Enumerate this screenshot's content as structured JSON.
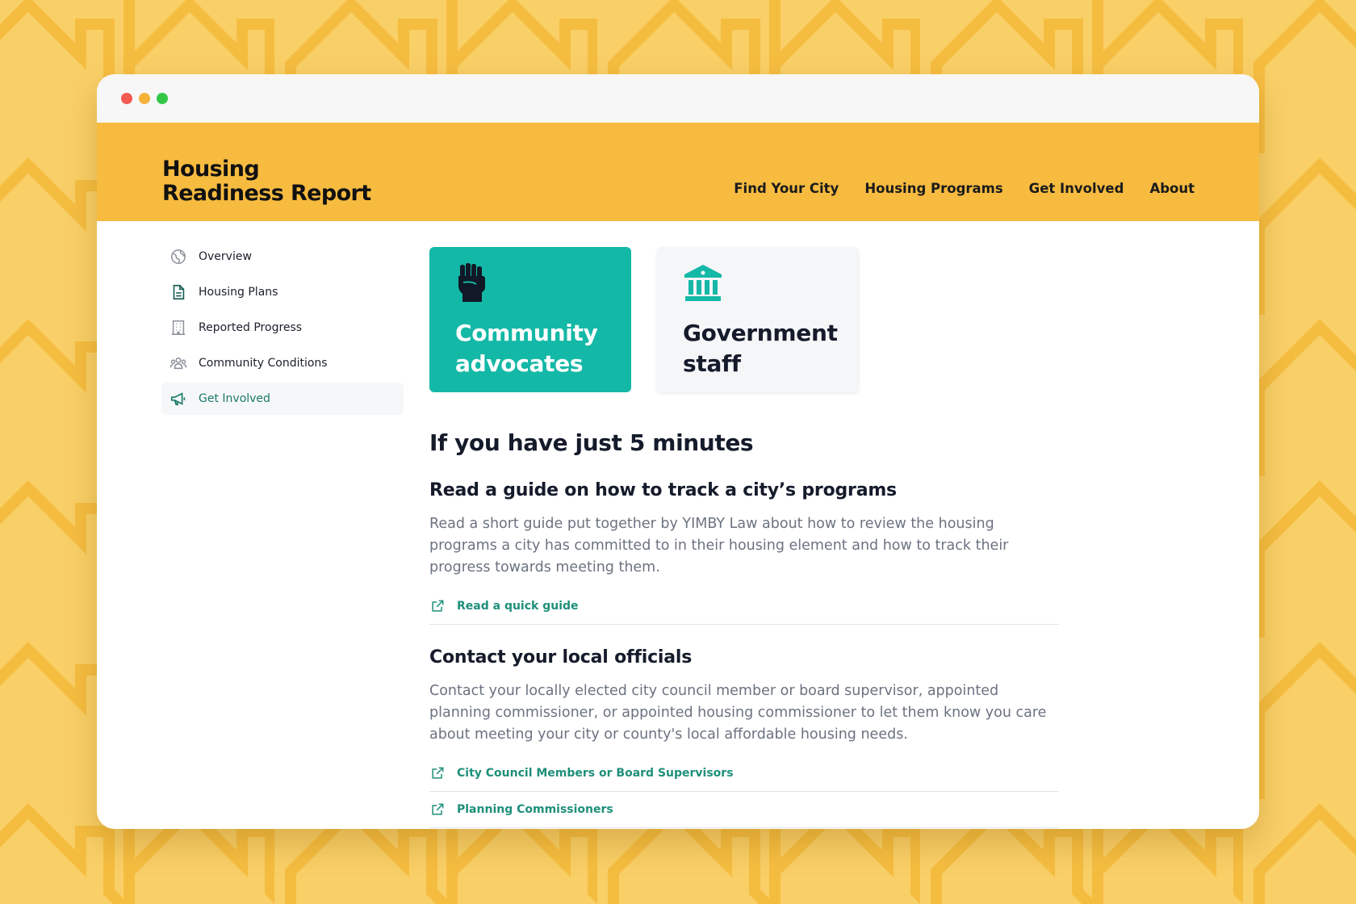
{
  "theme": {
    "background": "#f9cf67",
    "header": "#f7bb40",
    "teal": "#14b8a6",
    "link": "#1e8f7a",
    "text_dark": "#151b2b",
    "text_muted": "#6b7280"
  },
  "site": {
    "logo_line1": "Housing",
    "logo_line2": "Readiness Report"
  },
  "nav": [
    {
      "label": "Find Your City"
    },
    {
      "label": "Housing Programs"
    },
    {
      "label": "Get Involved"
    },
    {
      "label": "About"
    }
  ],
  "sidebar": {
    "active": "Get Involved",
    "items": [
      {
        "label": "Overview",
        "icon": "globe-icon"
      },
      {
        "label": "Housing Plans",
        "icon": "document-icon"
      },
      {
        "label": "Reported Progress",
        "icon": "building-icon"
      },
      {
        "label": "Community Conditions",
        "icon": "people-icon"
      },
      {
        "label": "Get Involved",
        "icon": "megaphone-icon"
      }
    ]
  },
  "audience_cards": [
    {
      "title_line1": "Community",
      "title_line2": "advocates",
      "icon": "raised-fist-icon",
      "selected": true
    },
    {
      "title_line1": "Government",
      "title_line2": "staff",
      "icon": "government-building-icon",
      "selected": false
    }
  ],
  "section": {
    "title": "If you have just 5 minutes",
    "blocks": [
      {
        "title": "Read a guide on how to track a city’s programs",
        "body": "Read a short guide put together by YIMBY Law about how to review the housing programs a city has committed to in their housing element and how to track their progress towards meeting them.",
        "links": [
          {
            "label": "Read a quick guide",
            "icon": "external-link-icon"
          }
        ]
      },
      {
        "title": "Contact your local officials",
        "body": "Contact your locally elected city council member or board supervisor, appointed planning commissioner, or appointed housing commissioner to let them know you care about meeting your city or county's local affordable housing needs.",
        "links": [
          {
            "label": "City Council Members or Board Supervisors",
            "icon": "external-link-icon"
          },
          {
            "label": "Planning Commissioners",
            "icon": "external-link-icon"
          }
        ]
      }
    ]
  }
}
